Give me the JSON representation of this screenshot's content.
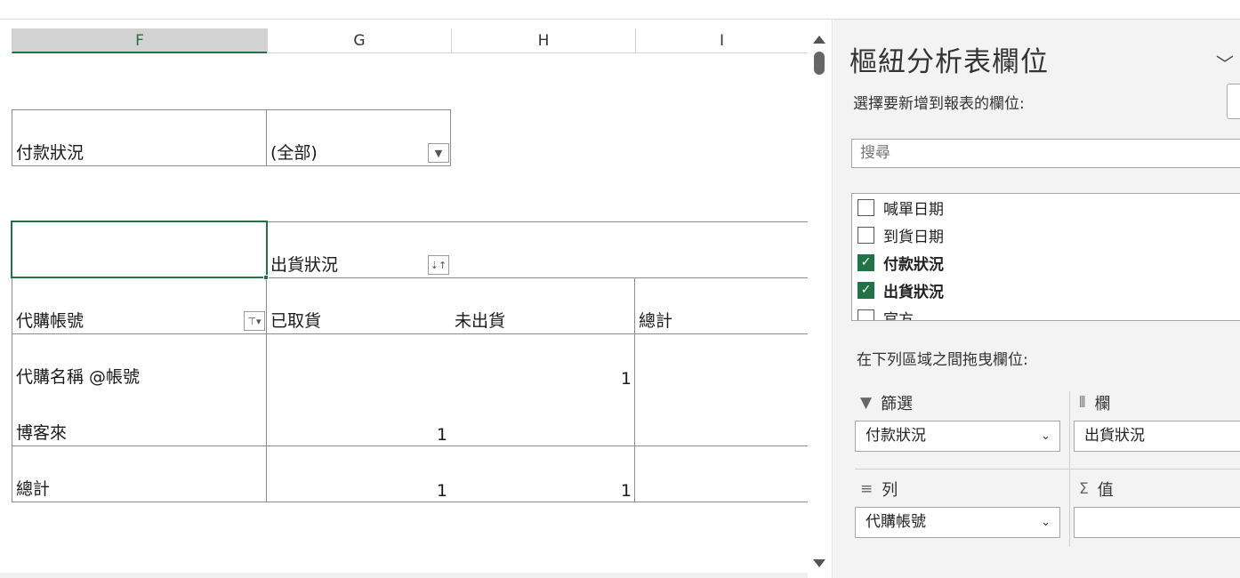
{
  "sheet": {
    "columns": [
      {
        "label": "F"
      },
      {
        "label": "G"
      },
      {
        "label": "H"
      },
      {
        "label": "I"
      }
    ],
    "filter": {
      "label": "付款狀況",
      "value": "(全部)"
    },
    "col_field": {
      "label": "出貨狀況"
    },
    "row_field": {
      "label": "代購帳號"
    },
    "col_headers": [
      "已取貨",
      "未出貨",
      "總計"
    ],
    "rows": [
      {
        "label": "代購名稱 @帳號",
        "g": "",
        "h": "1"
      },
      {
        "label": "博客來",
        "g": "1",
        "h": ""
      }
    ],
    "total": {
      "label": "總計",
      "g": "1",
      "h": "1"
    }
  },
  "pane": {
    "title": "樞紐分析表欄位",
    "subtitle": "選擇要新增到報表的欄位:",
    "search_placeholder": "搜尋",
    "fields": [
      {
        "label": "喊單日期",
        "checked": false
      },
      {
        "label": "到貨日期",
        "checked": false
      },
      {
        "label": "付款狀況",
        "checked": true
      },
      {
        "label": "出貨狀況",
        "checked": true
      },
      {
        "label": "官方",
        "checked": false
      }
    ],
    "drag_label": "在下列區域之間拖曳欄位:",
    "areas": {
      "filters": {
        "title": "篩選",
        "value": "付款狀況"
      },
      "columns": {
        "title": "欄",
        "value": "出貨狀況"
      },
      "rows": {
        "title": "列",
        "value": "代購帳號"
      },
      "values": {
        "title": "值",
        "value": ""
      }
    }
  },
  "colors": {
    "accent": "#217346"
  }
}
